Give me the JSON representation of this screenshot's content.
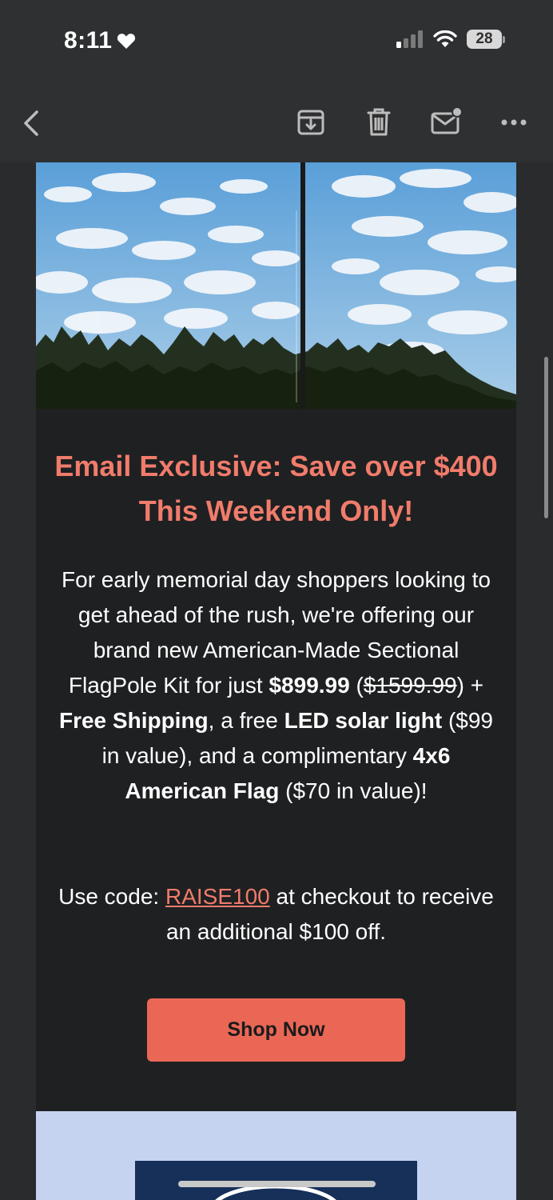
{
  "status": {
    "time": "8:11",
    "battery": "28"
  },
  "toolbar": {
    "icons": [
      "back-icon",
      "archive-icon",
      "trash-icon",
      "mark-unread-icon",
      "more-icon"
    ]
  },
  "email": {
    "headline": "Email Exclusive: Save over $400 This Weekend Only!",
    "body": {
      "p1": "For early memorial day shoppers looking to get ahead of the rush, we're offering our brand new American-Made Sectional FlagPole Kit for just ",
      "price": "$899.99",
      "paren_open": " (",
      "old_price": "$1599.99",
      "p2": ") + ",
      "free_shipping": "Free Shipping",
      "p3": ", a free ",
      "led": "LED solar light",
      "p4": " ($99 in value), and a complimentary ",
      "flag": "4x6 American Flag",
      "p5": " ($70 in value)!"
    },
    "code": {
      "prefix": "Use code: ",
      "code": "RAISE100",
      "suffix": " at checkout to receive an additional $100 off."
    },
    "button_label": "Shop Now"
  },
  "colors": {
    "accent": "#f07c6b",
    "button": "#ea6756",
    "background": "#1f2022"
  }
}
